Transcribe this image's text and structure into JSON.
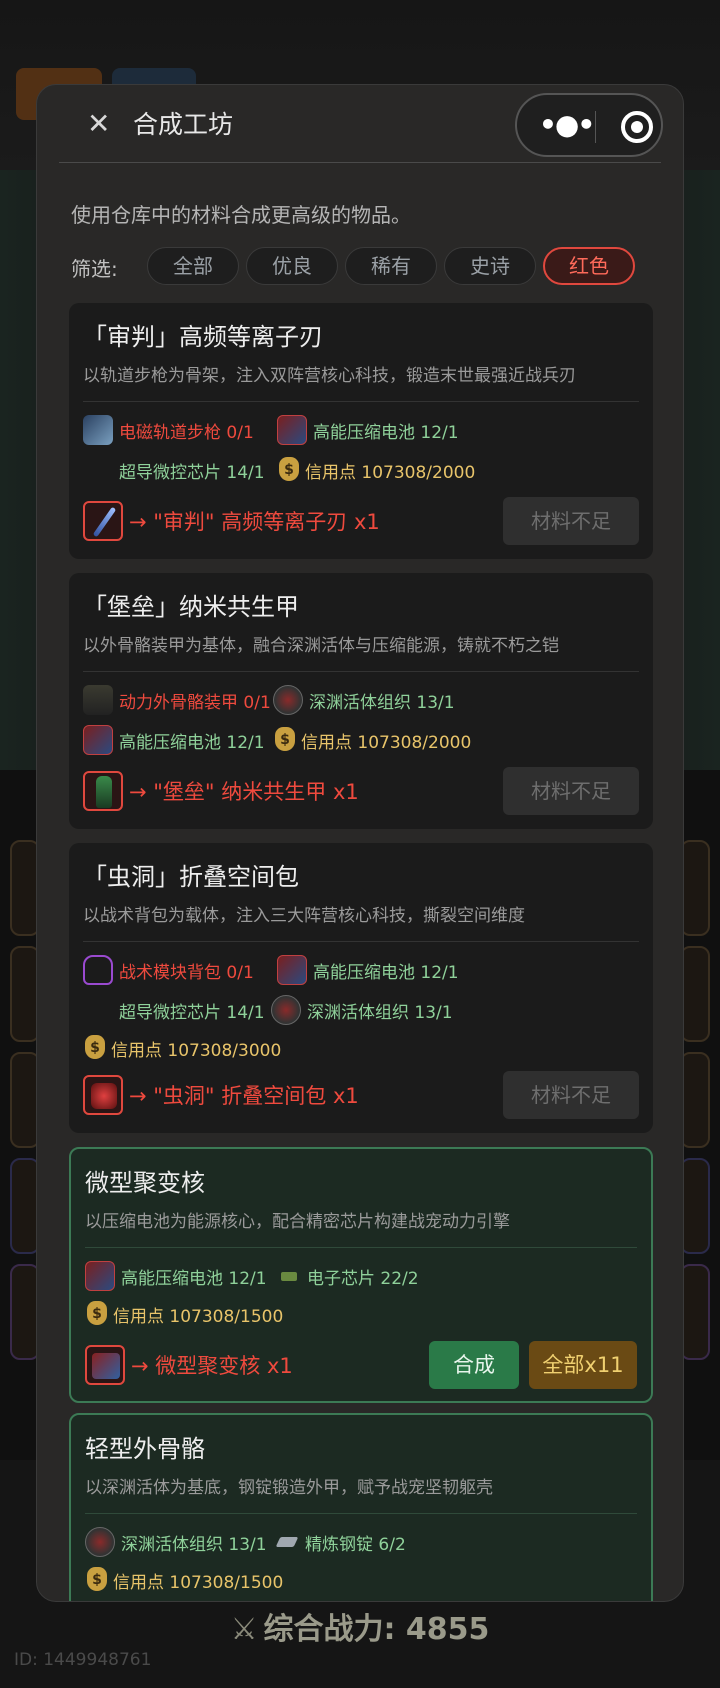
{
  "background": {
    "tab1": "",
    "tab2": "",
    "power_icon": "crossed-swords-icon",
    "power_text": "综合战力: 4855",
    "user_id": "ID: 1449948761"
  },
  "modal": {
    "title": "合成工坊",
    "description": "使用仓库中的材料合成更高级的物品。",
    "filter_label": "筛选:",
    "filters": [
      "全部",
      "优良",
      "稀有",
      "史诗",
      "红色"
    ],
    "active_filter": "红色"
  },
  "recipes": [
    {
      "name": "「审判」高频等离子刃",
      "desc": "以轨道步枪为骨架，注入双阵营核心科技，锻造末世最强近战兵刃",
      "materials": [
        {
          "icon": "railgun-icon",
          "text": "电磁轨道步枪 0/1",
          "status": "lack"
        },
        {
          "icon": "battery-icon",
          "text": "高能压缩电池 12/1",
          "status": "ok"
        },
        {
          "icon": "microchip-icon",
          "text": "超导微控芯片 14/1",
          "status": "ok"
        },
        {
          "icon": "coin-bag-icon",
          "text": "信用点 107308/2000",
          "status": "gold"
        }
      ],
      "result": "→ \"审判\" 高频等离子刃 x1",
      "button": "材料不足"
    },
    {
      "name": "「堡垒」纳米共生甲",
      "desc": "以外骨骼装甲为基体，融合深渊活体与压缩能源，铸就不朽之铠",
      "materials": [
        {
          "icon": "exoskeleton-icon",
          "text": "动力外骨骼装甲 0/1",
          "status": "lack"
        },
        {
          "icon": "abyss-tissue-icon",
          "text": "深渊活体组织 13/1",
          "status": "ok"
        },
        {
          "icon": "battery-icon",
          "text": "高能压缩电池 12/1",
          "status": "ok"
        },
        {
          "icon": "coin-bag-icon",
          "text": "信用点 107308/2000",
          "status": "gold"
        }
      ],
      "result": "→ \"堡垒\" 纳米共生甲 x1",
      "button": "材料不足"
    },
    {
      "name": "「虫洞」折叠空间包",
      "desc": "以战术背包为载体，注入三大阵营核心科技，撕裂空间维度",
      "materials": [
        {
          "icon": "backpack-icon",
          "text": "战术模块背包 0/1",
          "status": "lack"
        },
        {
          "icon": "battery-icon",
          "text": "高能压缩电池 12/1",
          "status": "ok"
        },
        {
          "icon": "microchip-icon",
          "text": "超导微控芯片 14/1",
          "status": "ok"
        },
        {
          "icon": "abyss-tissue-icon",
          "text": "深渊活体组织 13/1",
          "status": "ok"
        },
        {
          "icon": "coin-bag-icon",
          "text": "信用点 107308/3000",
          "status": "gold"
        }
      ],
      "result": "→ \"虫洞\" 折叠空间包 x1",
      "button": "材料不足"
    },
    {
      "name": "微型聚变核",
      "desc": "以压缩电池为能源核心，配合精密芯片构建战宠动力引擎",
      "materials": [
        {
          "icon": "battery-icon",
          "text": "高能压缩电池 12/1",
          "status": "ok"
        },
        {
          "icon": "electronic-chip-icon",
          "text": "电子芯片 22/2",
          "status": "ok"
        },
        {
          "icon": "coin-bag-icon",
          "text": "信用点 107308/1500",
          "status": "gold"
        }
      ],
      "result": "→ 微型聚变核 x1",
      "button_synth": "合成",
      "button_all": "全部x11"
    },
    {
      "name": "轻型外骨骼",
      "desc": "以深渊活体为基底，钢锭锻造外甲，赋予战宠坚韧躯壳",
      "materials": [
        {
          "icon": "abyss-tissue-icon",
          "text": "深渊活体组织 13/1",
          "status": "ok"
        },
        {
          "icon": "steel-ingot-icon",
          "text": "精炼钢锭 6/2",
          "status": "ok"
        },
        {
          "icon": "coin-bag-icon",
          "text": "信用点 107308/1500",
          "status": "gold"
        }
      ]
    }
  ],
  "colors": {
    "lack": "#ef4a3e",
    "ok": "#8fd19a",
    "gold": "#e8c46a",
    "accent_red": "#e0483e",
    "synth_green": "#2a7a48"
  }
}
